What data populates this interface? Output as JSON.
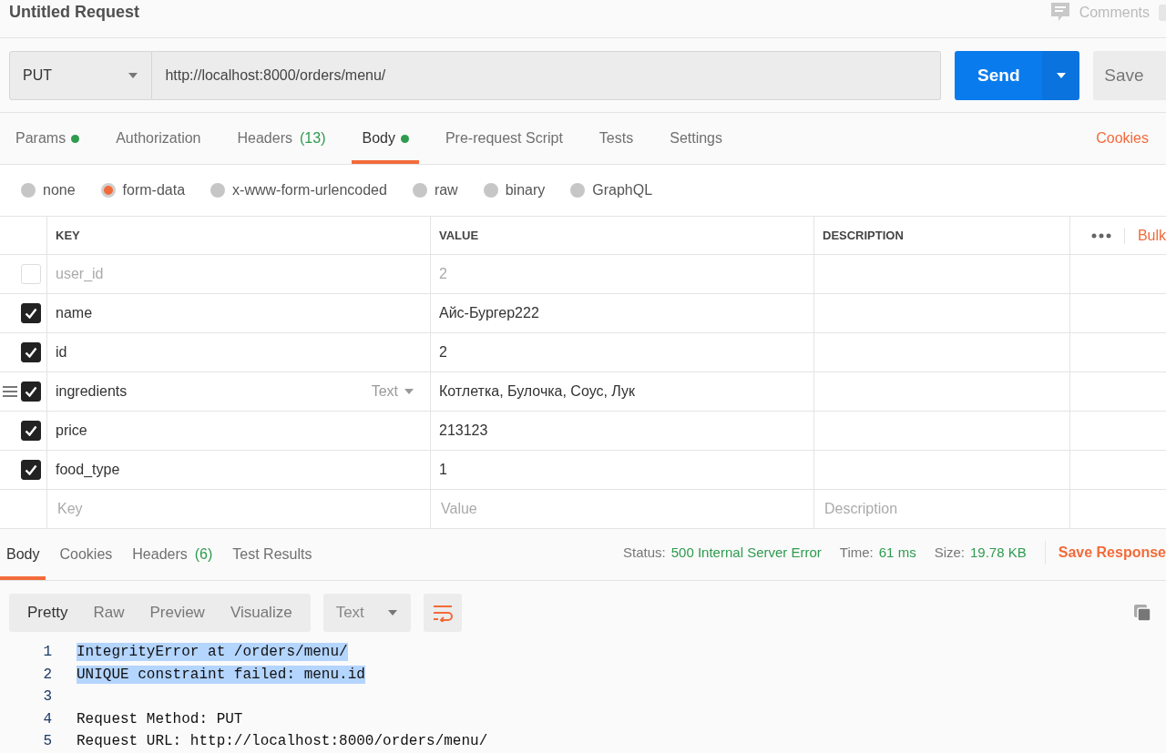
{
  "request": {
    "title": "Untitled Request",
    "comments_label": "Comments",
    "method": "PUT",
    "url": "http://localhost:8000/orders/menu/",
    "send_label": "Send",
    "save_label": "Save"
  },
  "request_tabs": [
    {
      "label": "Params",
      "indicator": true,
      "selected": false
    },
    {
      "label": "Authorization",
      "indicator": false,
      "selected": false
    },
    {
      "label": "Headers",
      "count": "(13)",
      "indicator": false,
      "selected": false
    },
    {
      "label": "Body",
      "indicator": true,
      "selected": true
    },
    {
      "label": "Pre-request Script",
      "indicator": false,
      "selected": false
    },
    {
      "label": "Tests",
      "indicator": false,
      "selected": false
    },
    {
      "label": "Settings",
      "indicator": false,
      "selected": false
    }
  ],
  "side_links": [
    "Cookies"
  ],
  "body_modes": [
    {
      "label": "none",
      "selected": false
    },
    {
      "label": "form-data",
      "selected": true
    },
    {
      "label": "x-www-form-urlencoded",
      "selected": false
    },
    {
      "label": "raw",
      "selected": false
    },
    {
      "label": "binary",
      "selected": false
    },
    {
      "label": "GraphQL",
      "selected": false
    }
  ],
  "table": {
    "columns": [
      "KEY",
      "VALUE",
      "DESCRIPTION"
    ],
    "bulk_label": "Bulk",
    "rows": [
      {
        "checked": false,
        "key": "user_id",
        "value": "2"
      },
      {
        "checked": true,
        "key": "name",
        "value": "Айс-Бургер222"
      },
      {
        "checked": true,
        "key": "id",
        "value": "2"
      },
      {
        "checked": true,
        "key": "ingredients",
        "type_label": "Text",
        "value": "Котлетка, Булочка, Соус, Лук"
      },
      {
        "checked": true,
        "key": "price",
        "value": "213123"
      },
      {
        "checked": true,
        "key": "food_type",
        "value": "1"
      }
    ],
    "new_row": {
      "key_placeholder": "Key",
      "value_placeholder": "Value",
      "description_placeholder": "Description"
    }
  },
  "response": {
    "tabs": [
      {
        "label": "Body",
        "selected": true
      },
      {
        "label": "Cookies",
        "selected": false
      },
      {
        "label": "Headers",
        "count": "(6)",
        "selected": false
      },
      {
        "label": "Test Results",
        "selected": false
      }
    ],
    "status_label": "Status:",
    "status": "500 Internal Server Error",
    "time_label": "Time:",
    "time": "61 ms",
    "size_label": "Size:",
    "size": "19.78 KB",
    "save_label": "Save Response",
    "views": [
      {
        "label": "Pretty",
        "selected": true
      },
      {
        "label": "Raw",
        "selected": false
      },
      {
        "label": "Preview",
        "selected": false
      },
      {
        "label": "Visualize",
        "selected": false
      }
    ],
    "format": "Text",
    "lines": [
      {
        "number": "1",
        "text": "IntegrityError at /orders/menu/",
        "selected": true
      },
      {
        "number": "2",
        "text": "UNIQUE constraint failed: menu.id",
        "selected": true
      },
      {
        "number": "3"
      },
      {
        "number": "4",
        "text": "Request Method: PUT",
        "selected": false
      },
      {
        "number": "5",
        "text": "Request URL: http://localhost:8000/orders/menu/",
        "selected": false
      }
    ]
  }
}
